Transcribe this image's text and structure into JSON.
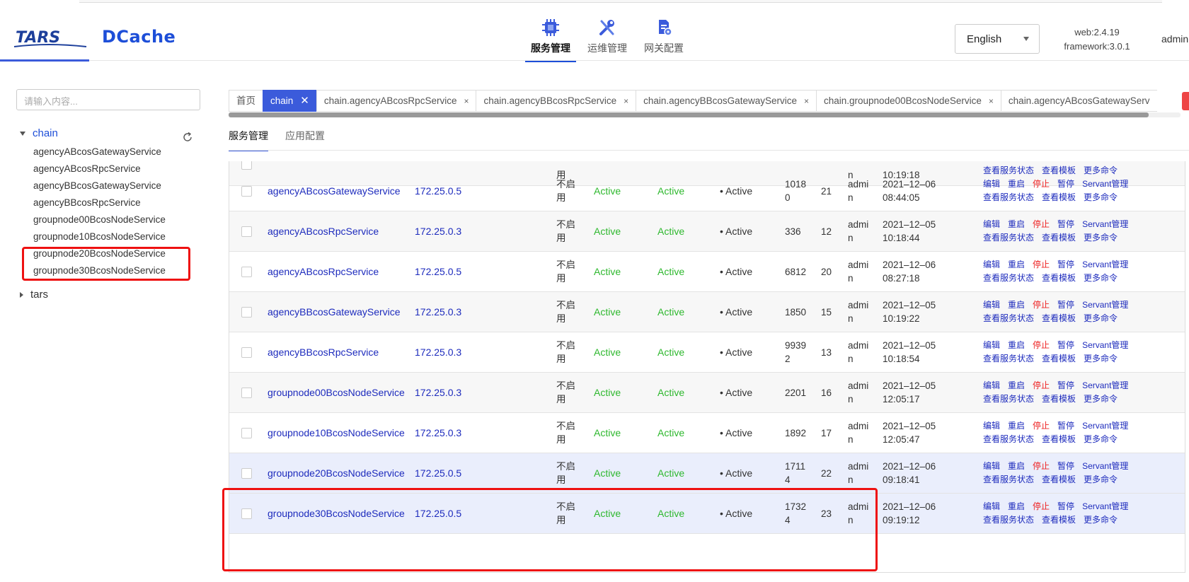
{
  "header": {
    "brand": "TARS",
    "brand2": "DCache",
    "nav": [
      {
        "label": "服务管理",
        "icon": "chip-icon"
      },
      {
        "label": "运维管理",
        "icon": "tools-icon"
      },
      {
        "label": "网关配置",
        "icon": "gateway-config-icon"
      }
    ],
    "language": "English",
    "web_version": "web:2.4.19",
    "framework_version": "framework:3.0.1",
    "user": "admin"
  },
  "sidebar": {
    "search_placeholder": "请输入内容...",
    "root": "chain",
    "children": [
      "agencyABcosGatewayService",
      "agencyABcosRpcService",
      "agencyBBcosGatewayService",
      "agencyBBcosRpcService",
      "groupnode00BcosNodeService",
      "groupnode10BcosNodeService",
      "groupnode20BcosNodeService",
      "groupnode30BcosNodeService"
    ],
    "other_root": "tars"
  },
  "tabs": [
    {
      "label": "首页"
    },
    {
      "label": "chain"
    },
    {
      "label": "chain.agencyABcosRpcService"
    },
    {
      "label": "chain.agencyBBcosRpcService"
    },
    {
      "label": "chain.agencyBBcosGatewayService"
    },
    {
      "label": "chain.groupnode00BcosNodeService"
    },
    {
      "label": "chain.agencyABcosGatewayServ"
    }
  ],
  "subtabs": [
    "服务管理",
    "应用配置"
  ],
  "ops_labels": {
    "edit": "编辑",
    "restart": "重启",
    "stop": "停止",
    "pause": "暂停",
    "servant": "Servant管理",
    "status": "查看服务状态",
    "template": "查看模板",
    "more": "更多命令"
  },
  "rows": [
    {
      "service": "agencyABcosGatewayService",
      "ip": "172.25.0.5",
      "enable": "不启用",
      "setting_state": "Active",
      "present_state": "Active",
      "status": "• Active",
      "pid": "10180",
      "patch": "21",
      "user": "admin",
      "time": "2021–12–06 08:44:05"
    },
    {
      "service": "agencyABcosRpcService",
      "ip": "172.25.0.3",
      "enable": "不启用",
      "setting_state": "Active",
      "present_state": "Active",
      "status": "• Active",
      "pid": "336",
      "patch": "12",
      "user": "admin",
      "time": "2021–12–05 10:18:44"
    },
    {
      "service": "agencyABcosRpcService",
      "ip": "172.25.0.5",
      "enable": "不启用",
      "setting_state": "Active",
      "present_state": "Active",
      "status": "• Active",
      "pid": "6812",
      "patch": "20",
      "user": "admin",
      "time": "2021–12–06 08:27:18"
    },
    {
      "service": "agencyBBcosGatewayService",
      "ip": "172.25.0.3",
      "enable": "不启用",
      "setting_state": "Active",
      "present_state": "Active",
      "status": "• Active",
      "pid": "1850",
      "patch": "15",
      "user": "admin",
      "time": "2021–12–05 10:19:22"
    },
    {
      "service": "agencyBBcosRpcService",
      "ip": "172.25.0.3",
      "enable": "不启用",
      "setting_state": "Active",
      "present_state": "Active",
      "status": "• Active",
      "pid": "99392",
      "patch": "13",
      "user": "admin",
      "time": "2021–12–05 10:18:54"
    },
    {
      "service": "groupnode00BcosNodeService",
      "ip": "172.25.0.3",
      "enable": "不启用",
      "setting_state": "Active",
      "present_state": "Active",
      "status": "• Active",
      "pid": "2201",
      "patch": "16",
      "user": "admin",
      "time": "2021–12–05 12:05:17"
    },
    {
      "service": "groupnode10BcosNodeService",
      "ip": "172.25.0.3",
      "enable": "不启用",
      "setting_state": "Active",
      "present_state": "Active",
      "status": "• Active",
      "pid": "1892",
      "patch": "17",
      "user": "admin",
      "time": "2021–12–05 12:05:47"
    },
    {
      "service": "groupnode20BcosNodeService",
      "ip": "172.25.0.5",
      "enable": "不启用",
      "setting_state": "Active",
      "present_state": "Active",
      "status": "• Active",
      "pid": "17114",
      "patch": "22",
      "user": "admin",
      "time": "2021–12–06 09:18:41"
    },
    {
      "service": "groupnode30BcosNodeService",
      "ip": "172.25.0.5",
      "enable": "不启用",
      "setting_state": "Active",
      "present_state": "Active",
      "status": "• Active",
      "pid": "17324",
      "patch": "23",
      "user": "admin",
      "time": "2021–12–06 09:19:12"
    }
  ],
  "partial_top_row": {
    "time": "10:19:18",
    "enable": "用",
    "user": "n"
  }
}
